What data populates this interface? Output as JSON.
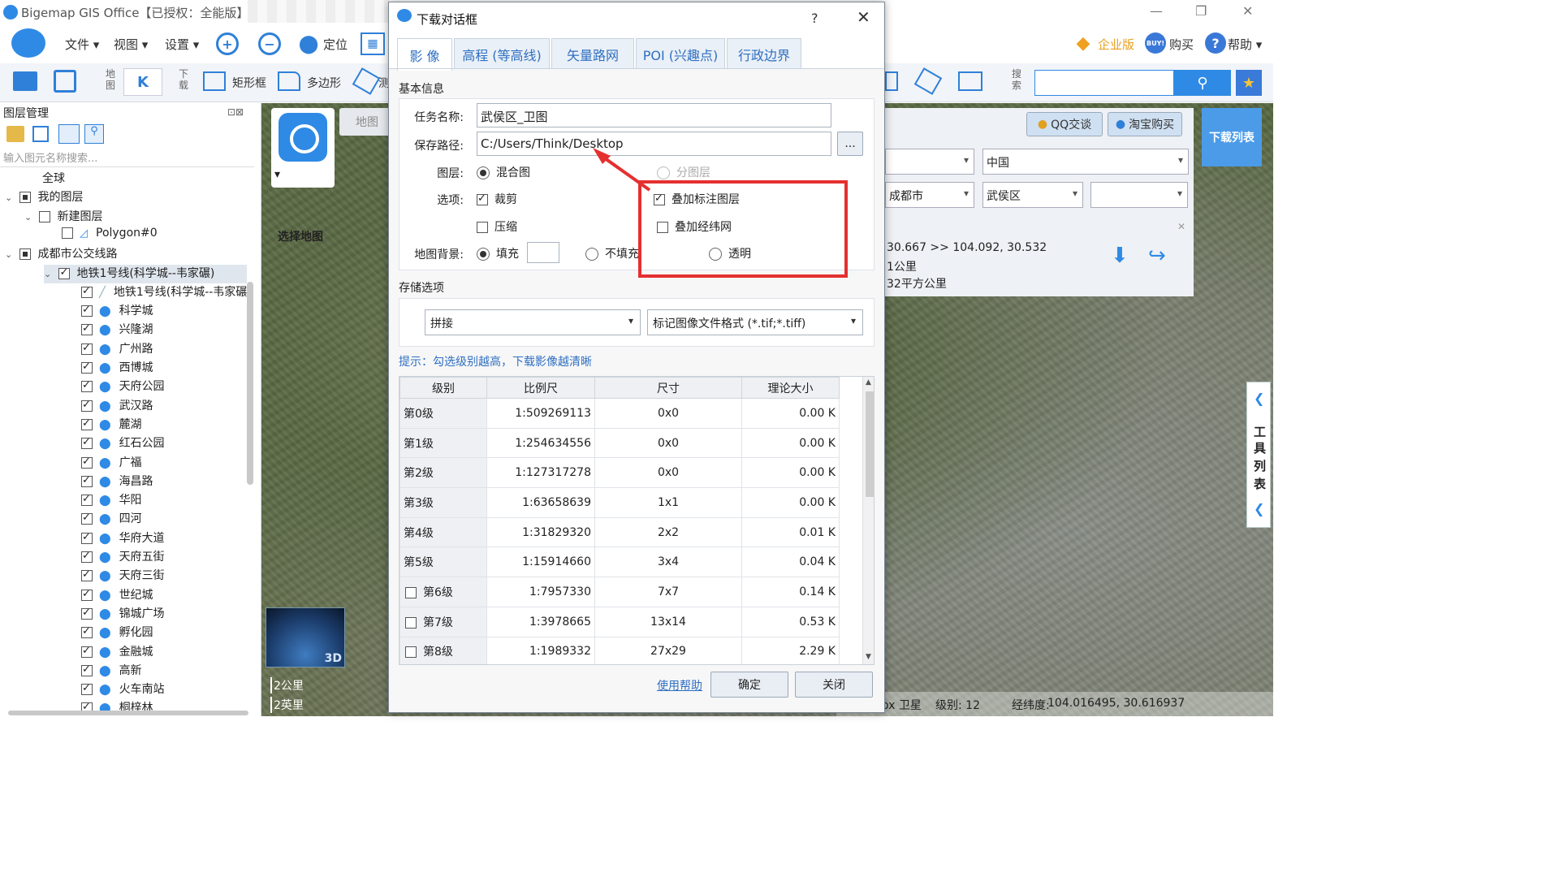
{
  "app": {
    "title": "Bigemap GIS Office【已授权：全能版】"
  },
  "menu": {
    "file": "文件",
    "view": "视图",
    "settings": "设置",
    "locate": "定位",
    "enterprise": "企业版",
    "buy": "购买",
    "help": "帮助",
    "buy_badge": "BUY!"
  },
  "toolbar2": {
    "map_label": "地图",
    "download_label": "下载",
    "rect": "矩形框",
    "polygon": "多边形",
    "measure": "测",
    "search_label": "搜索"
  },
  "layer_panel": {
    "title": "图层管理",
    "search_placeholder": "输入图元名称搜索...",
    "tree": [
      {
        "label": "全球",
        "level": 0
      },
      {
        "label": "我的图层",
        "level": 0
      },
      {
        "label": "新建图层",
        "level": 1
      },
      {
        "label": "Polygon#0",
        "level": 2
      },
      {
        "label": "成都市公交线路",
        "level": 0
      },
      {
        "label": "地铁1号线(科学城--韦家碾)",
        "level": 1
      },
      {
        "label": "地铁1号线(科学城--韦家碾)",
        "level": 2
      },
      {
        "label": "科学城",
        "level": 2
      },
      {
        "label": "兴隆湖",
        "level": 2
      },
      {
        "label": "广州路",
        "level": 2
      },
      {
        "label": "西博城",
        "level": 2
      },
      {
        "label": "天府公园",
        "level": 2
      },
      {
        "label": "武汉路",
        "level": 2
      },
      {
        "label": "麓湖",
        "level": 2
      },
      {
        "label": "红石公园",
        "level": 2
      },
      {
        "label": "广福",
        "level": 2
      },
      {
        "label": "海昌路",
        "level": 2
      },
      {
        "label": "华阳",
        "level": 2
      },
      {
        "label": "四河",
        "level": 2
      },
      {
        "label": "华府大道",
        "level": 2
      },
      {
        "label": "天府五街",
        "level": 2
      },
      {
        "label": "天府三街",
        "level": 2
      },
      {
        "label": "世纪城",
        "level": 2
      },
      {
        "label": "锦城广场",
        "level": 2
      },
      {
        "label": "孵化园",
        "level": 2
      },
      {
        "label": "金融城",
        "level": 2
      },
      {
        "label": "高新",
        "level": 2
      },
      {
        "label": "火车南站",
        "level": 2
      },
      {
        "label": "桐梓林",
        "level": 2
      }
    ]
  },
  "map": {
    "select_map": "选择地图",
    "map_tab": "地图",
    "globe_badge": "3D",
    "scale_km": "2公里",
    "scale_mi": "2英里",
    "qq": "QQ交谈",
    "taobao": "淘宝购买",
    "download_list": "下载列表",
    "country": "中国",
    "city": "成都市",
    "district": "武侯区",
    "coords_line": "30.667 >> 104.092, 30.532",
    "dist_line": "1公里",
    "area_line": "32平方公里",
    "tool_list": [
      "工",
      "具",
      "列",
      "表"
    ],
    "status_source": "ox 卫星",
    "status_level": "级别: 12",
    "status_coords_label": "经纬度:",
    "status_coords": "104.016495, 30.616937"
  },
  "dialog": {
    "title": "下载对话框",
    "help_glyph": "?",
    "tabs": [
      "影 像",
      "高程 (等高线)",
      "矢量路网",
      "POI (兴趣点)",
      "行政边界"
    ],
    "basic_info": "基本信息",
    "task_name_label": "任务名称:",
    "task_name": "武侯区_卫图",
    "save_path_label": "保存路径:",
    "save_path": "C:/Users/Think/Desktop",
    "browse": "...",
    "layer_label": "图层:",
    "layer_mixed": "混合图",
    "layer_split": "分图层",
    "options_label": "选项:",
    "opt_crop": "裁剪",
    "opt_compress": "压缩",
    "opt_overlay_label": "叠加标注图层",
    "opt_overlay_grid": "叠加经纬网",
    "bg_label": "地图背景:",
    "bg_fill": "填充",
    "bg_nofill": "不填充",
    "bg_transparent": "透明",
    "storage_label": "存储选项",
    "storage_mode": "拼接",
    "storage_format": "标记图像文件格式 (*.tif;*.tiff)",
    "hint": "提示：勾选级别越高，下载影像越清晰",
    "table_headers": [
      "级别",
      "比例尺",
      "尺寸",
      "理论大小"
    ],
    "rows": [
      {
        "level": "第0级",
        "scale": "1:509269113",
        "size": "0x0",
        "bytes": "0.00 K"
      },
      {
        "level": "第1级",
        "scale": "1:254634556",
        "size": "0x0",
        "bytes": "0.00 K"
      },
      {
        "level": "第2级",
        "scale": "1:127317278",
        "size": "0x0",
        "bytes": "0.00 K"
      },
      {
        "level": "第3级",
        "scale": "1:63658639",
        "size": "1x1",
        "bytes": "0.00 K"
      },
      {
        "level": "第4级",
        "scale": "1:31829320",
        "size": "2x2",
        "bytes": "0.01 K"
      },
      {
        "level": "第5级",
        "scale": "1:15914660",
        "size": "3x4",
        "bytes": "0.04 K"
      },
      {
        "level": "第6级",
        "scale": "1:7957330",
        "size": "7x7",
        "bytes": "0.14 K"
      },
      {
        "level": "第7级",
        "scale": "1:3978665",
        "size": "13x14",
        "bytes": "0.53 K"
      },
      {
        "level": "第8级",
        "scale": "1:1989332",
        "size": "27x29",
        "bytes": "2.29 K"
      }
    ],
    "help_link": "使用帮助",
    "ok": "确定",
    "close": "关闭"
  },
  "colors": {
    "accent": "#2f8ae5",
    "callout": "#e53030",
    "link": "#2f6fc2"
  }
}
